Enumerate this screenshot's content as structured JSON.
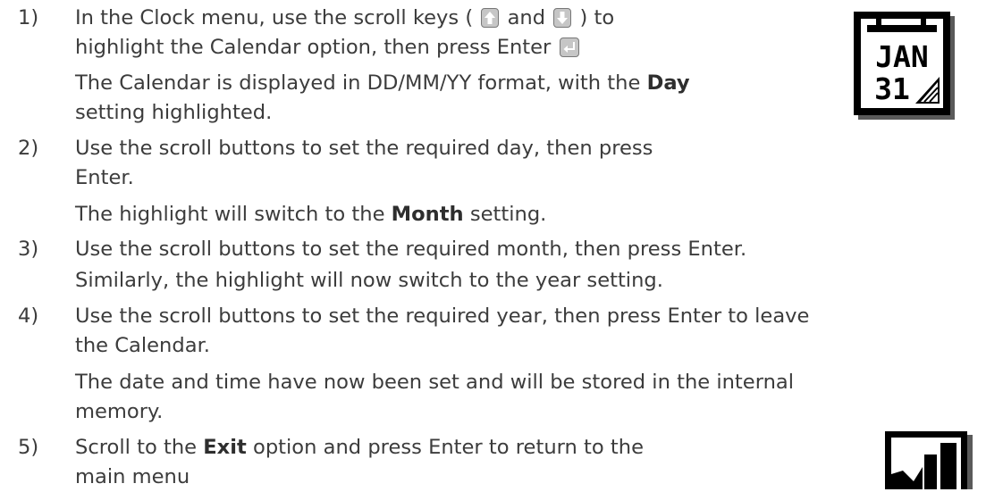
{
  "steps": [
    {
      "number": "1)",
      "l1a": "In the Clock menu, use the scroll keys (",
      "l1b": "and",
      "l1c": ") to",
      "l2a": "highlight the Calendar option, then press Enter",
      "n1a": "The Calendar is displayed in DD/MM/YY format, with the",
      "n1bold": "Day",
      "n2": "setting highlighted."
    },
    {
      "number": "2)",
      "l1": "Use the scroll buttons to set the required day, then press",
      "l2": "Enter.",
      "n1a": "The highlight will switch to the",
      "n1bold": "Month",
      "n1b": "setting."
    },
    {
      "number": "3)",
      "l1": "Use the scroll buttons to set the required month, then press Enter.",
      "n1": "Similarly, the highlight will now switch to the year setting."
    },
    {
      "number": "4)",
      "l1": "Use the scroll buttons to set the required year, then press Enter to leave",
      "l2": "the Calendar.",
      "n1": "The date and time have now been set and will be stored in the internal",
      "n2": "memory."
    },
    {
      "number": "5)",
      "l1a": "Scroll to the",
      "l1bold": "Exit",
      "l1b": "option and press Enter to return to the",
      "l2": "main menu"
    }
  ],
  "icons": {
    "scroll_up": "up-arrow-key-icon",
    "scroll_down": "down-arrow-key-icon",
    "enter": "enter-key-icon",
    "calendar": "calendar-icon",
    "exit": "exit-door-icon",
    "calendar_month": "JAN",
    "calendar_day": "31"
  }
}
